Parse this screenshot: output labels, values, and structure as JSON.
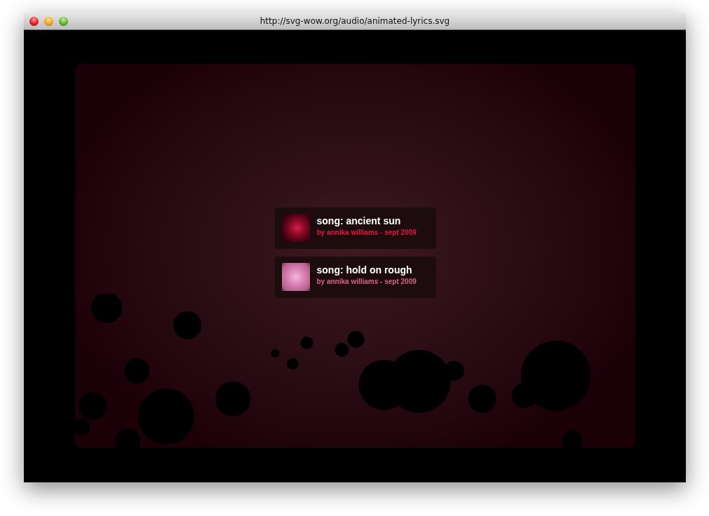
{
  "window": {
    "title": "http://svg-wow.org/audio/animated-lyrics.svg"
  },
  "songs": [
    {
      "title": "song: ancient sun",
      "byline": "by annika williams - sept 2009",
      "color": "#e8163e",
      "kind": "deep"
    },
    {
      "title": "song: hold on rough",
      "byline": "by annika williams - sept 2009",
      "color": "#d8628e",
      "kind": "light"
    }
  ]
}
